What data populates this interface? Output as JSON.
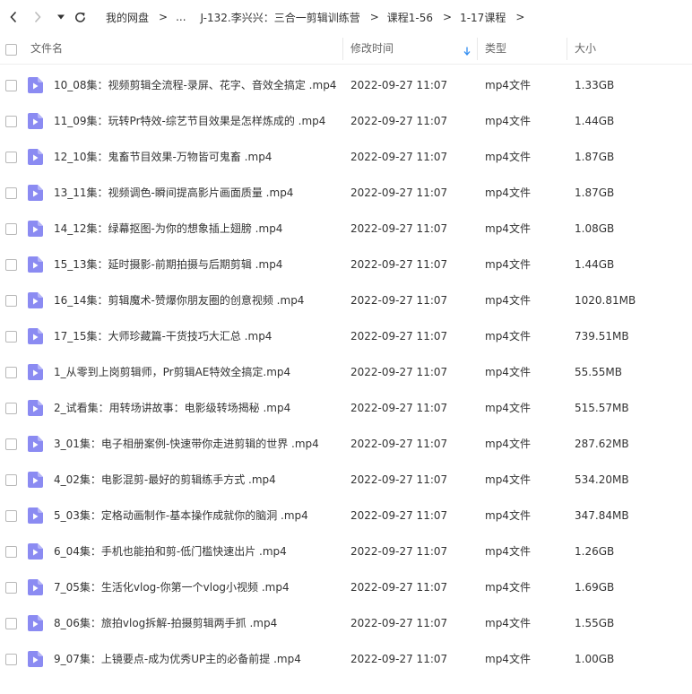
{
  "breadcrumb": {
    "items": [
      "我的网盘",
      "...",
      "J-132.李兴兴：三合一剪辑训练营",
      "课程1-56",
      "1-17课程"
    ]
  },
  "columns": {
    "name": "文件名",
    "modified": "修改时间",
    "type": "类型",
    "size": "大小"
  },
  "files": [
    {
      "name": "10_08集：视频剪辑全流程-录屏、花字、音效全搞定 .mp4",
      "modified": "2022-09-27 11:07",
      "type": "mp4文件",
      "size": "1.33GB"
    },
    {
      "name": "11_09集：玩转Pr特效-综艺节目效果是怎样炼成的 .mp4",
      "modified": "2022-09-27 11:07",
      "type": "mp4文件",
      "size": "1.44GB"
    },
    {
      "name": "12_10集：鬼畜节目效果-万物皆可鬼畜 .mp4",
      "modified": "2022-09-27 11:07",
      "type": "mp4文件",
      "size": "1.87GB"
    },
    {
      "name": "13_11集：视频调色-瞬间提高影片画面质量 .mp4",
      "modified": "2022-09-27 11:07",
      "type": "mp4文件",
      "size": "1.87GB"
    },
    {
      "name": "14_12集：绿幕抠图-为你的想象插上翅膀 .mp4",
      "modified": "2022-09-27 11:07",
      "type": "mp4文件",
      "size": "1.08GB"
    },
    {
      "name": "15_13集：延时摄影-前期拍摄与后期剪辑 .mp4",
      "modified": "2022-09-27 11:07",
      "type": "mp4文件",
      "size": "1.44GB"
    },
    {
      "name": "16_14集：剪辑魔术-赞爆你朋友圈的创意视频 .mp4",
      "modified": "2022-09-27 11:07",
      "type": "mp4文件",
      "size": "1020.81MB"
    },
    {
      "name": "17_15集：大师珍藏篇-干货技巧大汇总 .mp4",
      "modified": "2022-09-27 11:07",
      "type": "mp4文件",
      "size": "739.51MB"
    },
    {
      "name": "1_从零到上岗剪辑师，Pr剪辑AE特效全搞定.mp4",
      "modified": "2022-09-27 11:07",
      "type": "mp4文件",
      "size": "55.55MB"
    },
    {
      "name": "2_试看集：用转场讲故事：电影级转场揭秘 .mp4",
      "modified": "2022-09-27 11:07",
      "type": "mp4文件",
      "size": "515.57MB"
    },
    {
      "name": "3_01集：电子相册案例-快速带你走进剪辑的世界 .mp4",
      "modified": "2022-09-27 11:07",
      "type": "mp4文件",
      "size": "287.62MB"
    },
    {
      "name": "4_02集：电影混剪-最好的剪辑练手方式 .mp4",
      "modified": "2022-09-27 11:07",
      "type": "mp4文件",
      "size": "534.20MB"
    },
    {
      "name": "5_03集：定格动画制作-基本操作成就你的脑洞 .mp4",
      "modified": "2022-09-27 11:07",
      "type": "mp4文件",
      "size": "347.84MB"
    },
    {
      "name": "6_04集：手机也能拍和剪-低门槛快速出片 .mp4",
      "modified": "2022-09-27 11:07",
      "type": "mp4文件",
      "size": "1.26GB"
    },
    {
      "name": "7_05集：生活化vlog-你第一个vlog小视频 .mp4",
      "modified": "2022-09-27 11:07",
      "type": "mp4文件",
      "size": "1.69GB"
    },
    {
      "name": "8_06集：旅拍vlog拆解-拍摄剪辑两手抓 .mp4",
      "modified": "2022-09-27 11:07",
      "type": "mp4文件",
      "size": "1.55GB"
    },
    {
      "name": "9_07集：上镜要点-成为优秀UP主的必备前提 .mp4",
      "modified": "2022-09-27 11:07",
      "type": "mp4文件",
      "size": "1.00GB"
    }
  ],
  "icons": {
    "file": "video-file-icon",
    "sort": "sort-descending-icon"
  },
  "colors": {
    "file_icon": "#8b8bf2",
    "sort_arrow": "#2f8cf0",
    "text": "#333333",
    "header_text": "#666666"
  }
}
